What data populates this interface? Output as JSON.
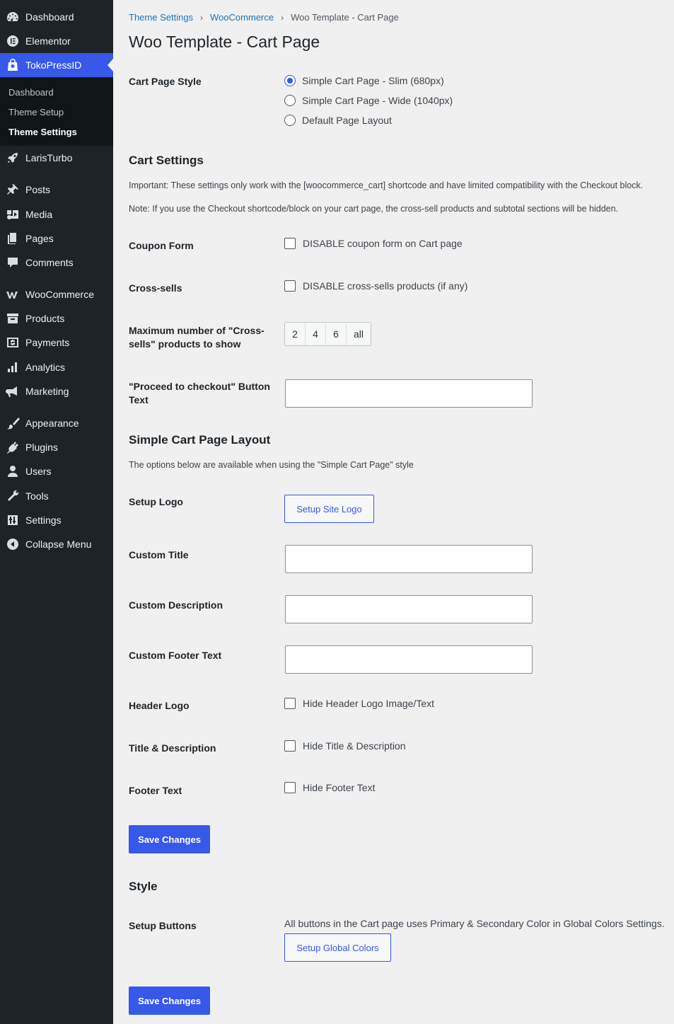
{
  "sidebar": {
    "items": [
      {
        "label": "Dashboard",
        "icon": "dashboard-icon"
      },
      {
        "label": "Elementor",
        "icon": "elementor-icon"
      },
      {
        "label": "TokoPressID",
        "icon": "shopping-bag-icon",
        "active": true
      },
      {
        "label": "LarisTurbo",
        "icon": "rocket-icon"
      },
      {
        "label": "Posts",
        "icon": "pin-icon"
      },
      {
        "label": "Media",
        "icon": "media-icon"
      },
      {
        "label": "Pages",
        "icon": "pages-icon"
      },
      {
        "label": "Comments",
        "icon": "comment-icon"
      },
      {
        "label": "WooCommerce",
        "icon": "woocommerce-icon"
      },
      {
        "label": "Products",
        "icon": "archive-icon"
      },
      {
        "label": "Payments",
        "icon": "dollar-icon"
      },
      {
        "label": "Analytics",
        "icon": "bar-chart-icon"
      },
      {
        "label": "Marketing",
        "icon": "megaphone-icon"
      },
      {
        "label": "Appearance",
        "icon": "paintbrush-icon"
      },
      {
        "label": "Plugins",
        "icon": "plug-icon"
      },
      {
        "label": "Users",
        "icon": "user-icon"
      },
      {
        "label": "Tools",
        "icon": "wrench-icon"
      },
      {
        "label": "Settings",
        "icon": "sliders-icon"
      },
      {
        "label": "Collapse Menu",
        "icon": "collapse-icon"
      }
    ],
    "submenu": [
      {
        "label": "Dashboard"
      },
      {
        "label": "Theme Setup"
      },
      {
        "label": "Theme Settings",
        "current": true
      }
    ]
  },
  "breadcrumb": {
    "items": [
      "Theme Settings",
      "WooCommerce"
    ],
    "current": "Woo Template - Cart Page",
    "separator": "›"
  },
  "page_title": "Woo Template - Cart Page",
  "cart_page_style": {
    "label": "Cart Page Style",
    "options": [
      {
        "label": "Simple Cart Page - Slim (680px)",
        "checked": true
      },
      {
        "label": "Simple Cart Page - Wide (1040px)",
        "checked": false
      },
      {
        "label": "Default Page Layout",
        "checked": false
      }
    ]
  },
  "cart_settings": {
    "title": "Cart Settings",
    "important": "Important: These settings only work with the [woocommerce_cart] shortcode and have limited compatibility with the Checkout block.",
    "note": "Note: If you use the Checkout shortcode/block on your cart page, the cross-sell products and subtotal sections will be hidden.",
    "coupon_label": "Coupon Form",
    "coupon_checkbox": "DISABLE coupon form on Cart page",
    "crosssells_label": "Cross-sells",
    "crosssells_checkbox": "DISABLE cross-sells products (if any)",
    "max_label": "Maximum number of \"Cross-sells\" products to show",
    "max_options": [
      "2",
      "4",
      "6",
      "all"
    ],
    "checkout_label": "\"Proceed to checkout\" Button Text",
    "checkout_value": ""
  },
  "simple_layout": {
    "title": "Simple Cart Page Layout",
    "desc": "The options below are available when using the \"Simple Cart Page\" style",
    "logo_label": "Setup Logo",
    "logo_button": "Setup Site Logo",
    "title_label": "Custom Title",
    "title_value": "",
    "desc_label": "Custom Description",
    "desc_value": "",
    "footer_label": "Custom Footer Text",
    "footer_value": "",
    "header_logo_label": "Header Logo",
    "header_logo_checkbox": "Hide Header Logo Image/Text",
    "title_desc_label": "Title & Description",
    "title_desc_checkbox": "Hide Title & Description",
    "footer_text_label": "Footer Text",
    "footer_text_checkbox": "Hide Footer Text"
  },
  "save_label": "Save Changes",
  "style": {
    "title": "Style",
    "buttons_label": "Setup Buttons",
    "buttons_desc": "All buttons in the Cart page uses Primary & Secondary Color in Global Colors Settings.",
    "colors_button": "Setup Global Colors"
  },
  "colors": {
    "accent": "#3858e9",
    "sidebar": "#1d2327",
    "background": "#f0f0f1"
  }
}
